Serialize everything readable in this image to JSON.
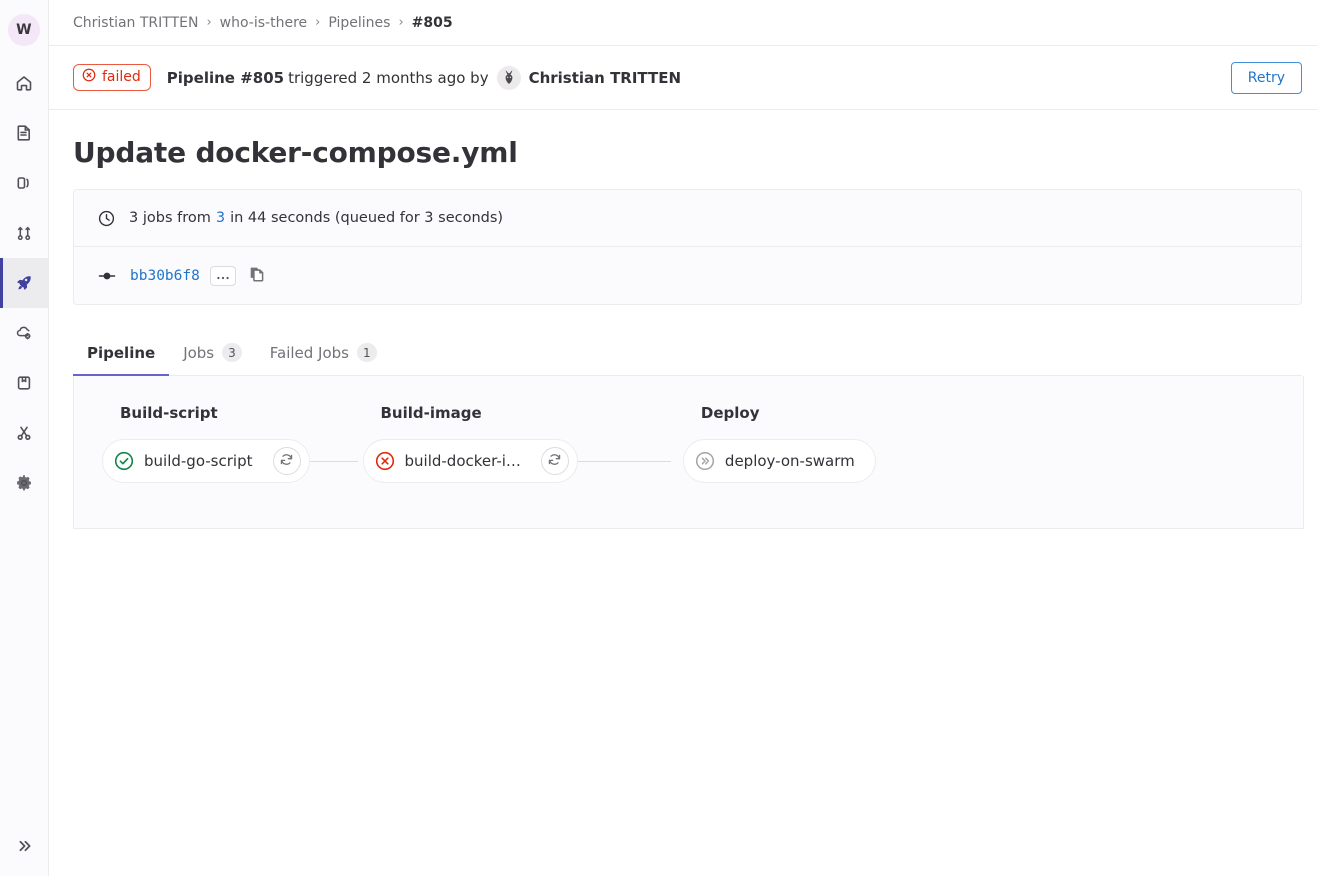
{
  "sidebar": {
    "avatar_initial": "W",
    "items": [
      {
        "name": "home",
        "icon": "home-icon",
        "active": false
      },
      {
        "name": "issues-board",
        "icon": "document-icon",
        "active": false
      },
      {
        "name": "issues",
        "icon": "issues-icon",
        "active": false
      },
      {
        "name": "merge-requests",
        "icon": "merge-request-icon",
        "active": false
      },
      {
        "name": "ci-cd",
        "icon": "rocket-icon",
        "active": true
      },
      {
        "name": "deployments",
        "icon": "cloud-gear-icon",
        "active": false
      },
      {
        "name": "packages",
        "icon": "package-icon",
        "active": false
      },
      {
        "name": "snippets",
        "icon": "scissors-icon",
        "active": false
      },
      {
        "name": "settings",
        "icon": "gear-icon",
        "active": false
      }
    ],
    "expand_label": "expand-sidebar"
  },
  "breadcrumb": {
    "items": [
      "Christian TRITTEN",
      "who-is-there",
      "Pipelines"
    ],
    "current": "#805",
    "separator": "›"
  },
  "status": {
    "badge_label": "failed",
    "badge_icon": "status-failed-icon",
    "pipeline_label": "Pipeline #805",
    "triggered_text": "triggered 2 months ago by",
    "user_name": "Christian TRITTEN",
    "retry_label": "Retry"
  },
  "page": {
    "title": "Update docker-compose.yml"
  },
  "info_card": {
    "duration_prefix": "3 jobs from",
    "branch": "3",
    "duration_suffix": "in 44 seconds (queued for 3 seconds)",
    "clock_icon": "clock-icon",
    "commit_icon": "commit-icon",
    "commit_sha": "bb30b6f8",
    "ellipsis_label": "…",
    "copy_icon": "copy-icon"
  },
  "tabs": [
    {
      "label": "Pipeline",
      "badge": "",
      "active": true
    },
    {
      "label": "Jobs",
      "badge": "3",
      "active": false
    },
    {
      "label": "Failed Jobs",
      "badge": "1",
      "active": false
    }
  ],
  "pipeline": {
    "stages": [
      {
        "title": "Build-script",
        "job_name": "build-go-script",
        "status": "success",
        "has_retry": true
      },
      {
        "title": "Build-image",
        "job_name": "build-docker-i…",
        "status": "failed",
        "has_retry": true
      },
      {
        "title": "Deploy",
        "job_name": "deploy-on-swarm",
        "status": "skipped",
        "has_retry": false
      }
    ]
  },
  "colors": {
    "accent_blue": "#1f75cb",
    "danger_red": "#dd2b0e",
    "success_green": "#108548",
    "tab_active": "#6666c4",
    "nav_active": "#41419f",
    "muted": "#737278"
  }
}
